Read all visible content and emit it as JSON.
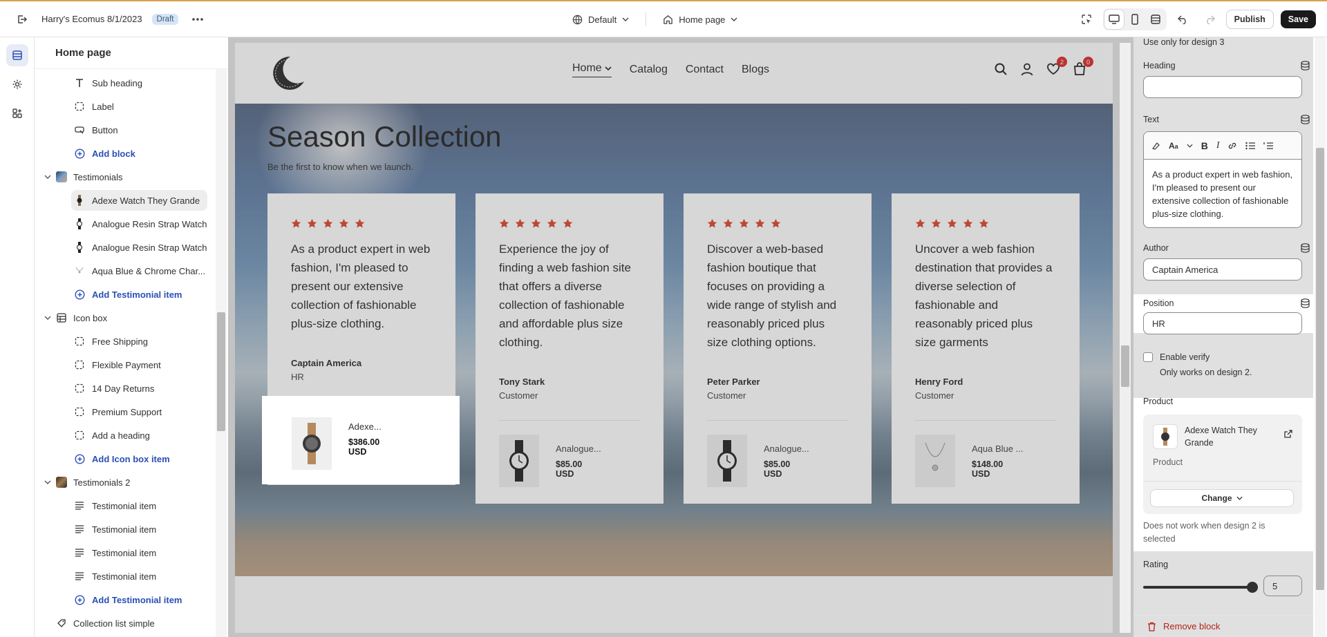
{
  "topbar": {
    "store_title": "Harry's Ecomus 8/1/2023",
    "status_badge": "Draft",
    "theme_selector": "Default",
    "page_selector": "Home page",
    "publish_label": "Publish",
    "save_label": "Save"
  },
  "sidebar": {
    "title": "Home page",
    "items": [
      {
        "label": "Sub heading",
        "icon": "text-icon"
      },
      {
        "label": "Label",
        "icon": "block-icon"
      },
      {
        "label": "Button",
        "icon": "button-icon"
      },
      {
        "label": "Add block",
        "icon": "plus-circle-icon"
      },
      {
        "label": "Testimonials",
        "icon": "section-thumbnail"
      },
      {
        "label": "Adexe Watch They Grande",
        "icon": "watch-thumbnail"
      },
      {
        "label": "Analogue Resin Strap Watch",
        "icon": "watch-thumbnail"
      },
      {
        "label": "Analogue Resin Strap Watch",
        "icon": "watch-thumbnail"
      },
      {
        "label": "Aqua Blue & Chrome Char...",
        "icon": "necklace-thumbnail"
      },
      {
        "label": "Add Testimonial item",
        "icon": "plus-circle-icon"
      },
      {
        "label": "Icon box",
        "icon": "grid-icon"
      },
      {
        "label": "Free Shipping",
        "icon": "block-icon"
      },
      {
        "label": "Flexible Payment",
        "icon": "block-icon"
      },
      {
        "label": "14 Day Returns",
        "icon": "block-icon"
      },
      {
        "label": "Premium Support",
        "icon": "block-icon"
      },
      {
        "label": "Add a heading",
        "icon": "block-icon"
      },
      {
        "label": "Add Icon box item",
        "icon": "plus-circle-icon"
      },
      {
        "label": "Testimonials 2",
        "icon": "section-thumbnail"
      },
      {
        "label": "Testimonial item",
        "icon": "lines-icon"
      },
      {
        "label": "Testimonial item",
        "icon": "lines-icon"
      },
      {
        "label": "Testimonial item",
        "icon": "lines-icon"
      },
      {
        "label": "Testimonial item",
        "icon": "lines-icon"
      },
      {
        "label": "Add Testimonial item",
        "icon": "plus-circle-icon"
      },
      {
        "label": "Collection list simple",
        "icon": "collection-icon"
      }
    ]
  },
  "store": {
    "nav": [
      "Home",
      "Catalog",
      "Contact",
      "Blogs"
    ],
    "wishlist_count": "2",
    "cart_count": "0",
    "hero_title": "Season Collection",
    "hero_subtitle": "Be the first to know when we launch.",
    "cards": [
      {
        "quote": "As a product expert in web fashion, I'm pleased to present our extensive collection of fashionable plus-size clothing.",
        "author": "Captain America",
        "role": "HR",
        "product_name": "Adexe...",
        "price": "$386.00",
        "currency": "USD",
        "rating": 5
      },
      {
        "quote": "Experience the joy of finding a web fashion site that offers a diverse collection of fashionable and affordable plus size clothing.",
        "author": "Tony Stark",
        "role": "Customer",
        "product_name": "Analogue...",
        "price": "$85.00",
        "currency": "USD",
        "rating": 5
      },
      {
        "quote": "Discover a web-based fashion boutique that focuses on providing a wide range of stylish and reasonably priced plus size clothing options.",
        "author": "Peter Parker",
        "role": "Customer",
        "product_name": "Analogue...",
        "price": "$85.00",
        "currency": "USD",
        "rating": 5
      },
      {
        "quote": "Uncover a web fashion destination that provides a diverse selection of fashionable and reasonably priced plus size garments",
        "author": "Henry Ford",
        "role": "Customer",
        "product_name": "Aqua Blue ...",
        "price": "$148.00",
        "currency": "USD",
        "rating": 5
      }
    ]
  },
  "settings": {
    "design_note": "Use only for design 3",
    "heading_label": "Heading",
    "heading_value": "",
    "text_label": "Text",
    "text_value": "As a product expert in web fashion, I'm pleased to present our extensive collection of fashionable plus-size clothing.",
    "author_label": "Author",
    "author_value": "Captain America",
    "position_label": "Position",
    "position_value": "HR",
    "verify_label": "Enable verify",
    "verify_note": "Only works on design 2.",
    "product_label": "Product",
    "product_name": "Adexe Watch They Grande",
    "product_type": "Product",
    "change_label": "Change",
    "product_note": "Does not work when design 2 is selected",
    "rating_label": "Rating",
    "rating_value": "5",
    "remove_label": "Remove block"
  }
}
